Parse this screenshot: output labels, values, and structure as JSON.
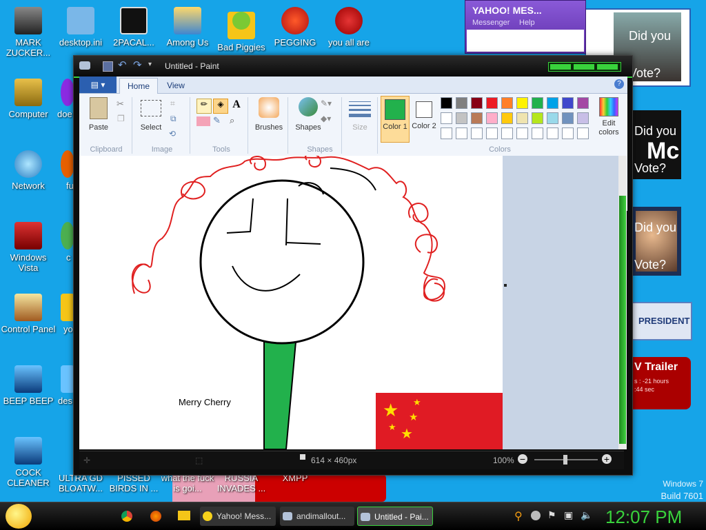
{
  "desktop_icons": [
    {
      "label": "MARK ZUCKER..."
    },
    {
      "label": "desktop.ini"
    },
    {
      "label": "2PACAL..."
    },
    {
      "label": "Among Us"
    },
    {
      "label": "Bad Piggies"
    },
    {
      "label": "PEGGING"
    },
    {
      "label": "you all are"
    },
    {
      "label": "Computer"
    },
    {
      "label": "Network"
    },
    {
      "label": "Windows Vista"
    },
    {
      "label": "Control Panel"
    },
    {
      "label": "BEEP BEEP"
    },
    {
      "label": "COCK CLEANER"
    },
    {
      "label": "ULTRA GD BLOATW..."
    },
    {
      "label": "PISSED BIRDS IN ..."
    },
    {
      "label": "what the fuck is goi..."
    },
    {
      "label": "RUSSIA INVADES ..."
    },
    {
      "label": "XMPP"
    },
    {
      "label": "doe"
    },
    {
      "label": "fu"
    },
    {
      "label": "c"
    },
    {
      "label": "yo"
    },
    {
      "label": "des"
    }
  ],
  "yahoo": {
    "title": "YAHOO! MES...",
    "menu1": "Messenger",
    "menu2": "Help"
  },
  "paint": {
    "title": "Untitled - Paint",
    "tabs": [
      "Home",
      "View"
    ],
    "groups": {
      "clipboard": "Clipboard",
      "image": "Image",
      "tools": "Tools",
      "shapes": "Shapes",
      "colors": "Colors"
    },
    "buttons": {
      "paste": "Paste",
      "select": "Select",
      "brushes": "Brushes",
      "shapes": "Shapes",
      "size": "Size",
      "color1": "Color 1",
      "color2": "Color 2",
      "edit_colors": "Edit colors"
    },
    "palette_row1": [
      "#000000",
      "#7f7f7f",
      "#880015",
      "#ed1c24",
      "#ff7f27",
      "#fff200",
      "#22b14c",
      "#00a2e8",
      "#3f48cc",
      "#a349a4"
    ],
    "palette_row2": [
      "#ffffff",
      "#c3c3c3",
      "#b97a57",
      "#ffaec9",
      "#ffc90e",
      "#efe4b0",
      "#b5e61d",
      "#99d9ea",
      "#7092be",
      "#c8bfe7"
    ],
    "color1": "#22b14c",
    "color2": "#ffffff",
    "canvas_text": "Merry Cherry",
    "status_size": "614 × 460px",
    "zoom": "100%"
  },
  "sidebar_ads": {
    "q1": "Did you",
    "q2": "Vote?",
    "mc": "Mc",
    "president": "PRESIDENT",
    "trailer": "V Trailer",
    "trailer_sub": "s : -21 hours",
    "trailer_sub2": ":44 sec"
  },
  "watermark": {
    "line1": "Windows 7",
    "line2": "Build 7601"
  },
  "taskbar": {
    "items": [
      "Yahoo! Mess...",
      "andimallout...",
      "Untitled - Pai..."
    ],
    "clock": "12:07 PM"
  }
}
